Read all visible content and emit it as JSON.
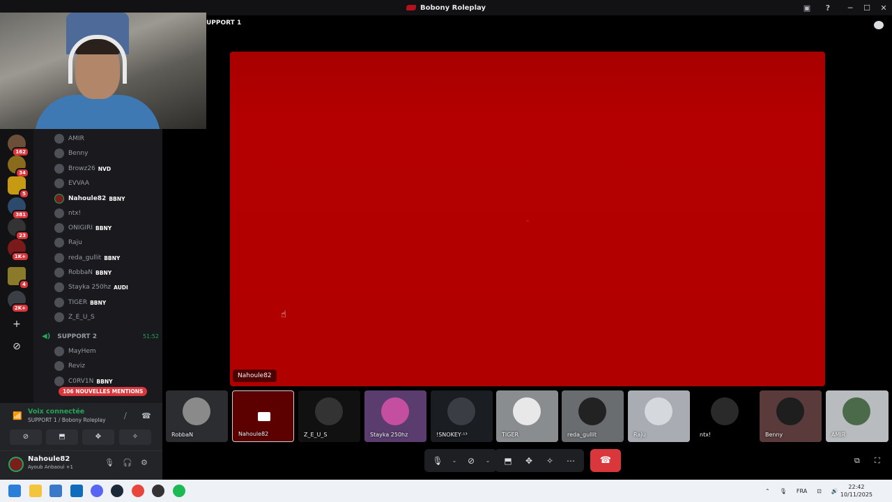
{
  "window": {
    "title": "Bobony Roleplay"
  },
  "header": {
    "channel_name": "UPPORT 1"
  },
  "rail": {
    "badges": [
      "162",
      "34",
      "5",
      "381",
      "23",
      "1K+",
      "4",
      "2K+"
    ]
  },
  "members": [
    {
      "name": "AMIR",
      "tag": ""
    },
    {
      "name": "Benny",
      "tag": ""
    },
    {
      "name": "Browz26",
      "tag": "NVD"
    },
    {
      "name": "EVVAA",
      "tag": ""
    },
    {
      "name": "Nahoule82",
      "tag": "BBNY"
    },
    {
      "name": "ntx!",
      "tag": ""
    },
    {
      "name": "ONIGIRI",
      "tag": "BBNY"
    },
    {
      "name": "Raju",
      "tag": ""
    },
    {
      "name": "reda_gullit",
      "tag": "BBNY"
    },
    {
      "name": "RobbaN",
      "tag": "BBNY"
    },
    {
      "name": "Stayka 250hz",
      "tag": "AUDI"
    },
    {
      "name": "TIGER",
      "tag": "BBNY"
    },
    {
      "name": "Z_E_U_S",
      "tag": ""
    }
  ],
  "support2": {
    "label": "SUPPORT 2",
    "time": "51:52"
  },
  "support2_members": [
    {
      "name": "MayHem",
      "tag": ""
    },
    {
      "name": "Reviz",
      "tag": ""
    },
    {
      "name": "C0RV1N",
      "tag": "BBNY"
    }
  ],
  "mentions_badge": "106 NOUVELLES MENTIONS",
  "stage": {
    "speaker": "Nahoule82"
  },
  "tiles": [
    "RobbaN",
    "Nahoule82",
    "Z_E_U_S",
    "Stayka 250hz",
    "!SNOKEY·¹³",
    "TIGER",
    "reda_gullit",
    "Raju",
    "ntx!",
    "Benny",
    "AMIR"
  ],
  "voice": {
    "status": "Voix connectée",
    "location": "SUPPORT 1 / Bobony Roleplay"
  },
  "user": {
    "name": "Nahoule82",
    "activity": "Ayoub Anbaoui +1"
  },
  "taskbar": {
    "lang": "FRA",
    "time": "22:42",
    "date": "10/11/2025"
  },
  "colors": {
    "stage_red": "#b00000",
    "online_green": "#23a55a",
    "danger": "#da373c"
  }
}
